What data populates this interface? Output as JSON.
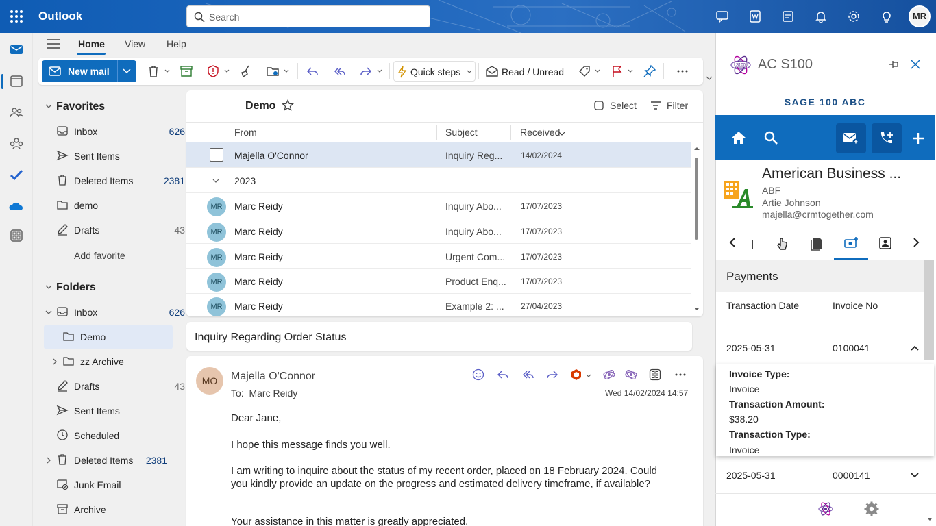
{
  "app": {
    "brand": "Outlook",
    "search_placeholder": "Search",
    "avatar_initials": "MR"
  },
  "tabs": [
    "Home",
    "View",
    "Help"
  ],
  "ribbon": {
    "new_mail": "New mail",
    "quick_steps": "Quick steps",
    "read_unread": "Read / Unread"
  },
  "favorites": {
    "title": "Favorites",
    "items": [
      {
        "label": "Inbox",
        "count": "626"
      },
      {
        "label": "Sent Items",
        "count": ""
      },
      {
        "label": "Deleted Items",
        "count": "2381"
      },
      {
        "label": "demo",
        "count": ""
      },
      {
        "label": "Drafts",
        "count": "43"
      }
    ],
    "add": "Add favorite"
  },
  "folders": {
    "title": "Folders",
    "items": [
      {
        "label": "Inbox",
        "count": "626"
      },
      {
        "label": "Demo",
        "count": ""
      },
      {
        "label": "zz Archive",
        "count": ""
      },
      {
        "label": "Drafts",
        "count": "43"
      },
      {
        "label": "Sent Items",
        "count": ""
      },
      {
        "label": "Scheduled",
        "count": ""
      },
      {
        "label": "Deleted Items",
        "count": "2381"
      },
      {
        "label": "Junk Email",
        "count": ""
      },
      {
        "label": "Archive",
        "count": ""
      }
    ]
  },
  "list": {
    "title": "Demo",
    "select": "Select",
    "filter": "Filter",
    "columns": {
      "from": "From",
      "subject": "Subject",
      "received": "Received"
    },
    "pinned": {
      "from": "Majella O'Connor",
      "subject": "Inquiry Reg...",
      "date": "14/02/2024"
    },
    "group": "2023",
    "rows": [
      {
        "initials": "MR",
        "from": "Marc Reidy",
        "subject": "Inquiry Abo...",
        "date": "17/07/2023"
      },
      {
        "initials": "MR",
        "from": "Marc Reidy",
        "subject": "Inquiry Abo...",
        "date": "17/07/2023"
      },
      {
        "initials": "MR",
        "from": "Marc Reidy",
        "subject": "Urgent Com...",
        "date": "17/07/2023"
      },
      {
        "initials": "MR",
        "from": "Marc Reidy",
        "subject": "Product Enq...",
        "date": "17/07/2023"
      },
      {
        "initials": "MR",
        "from": "Marc Reidy",
        "subject": "Example 2: ...",
        "date": "27/04/2023"
      }
    ]
  },
  "message": {
    "subject": "Inquiry Regarding Order Status",
    "sender_initials": "MO",
    "sender": "Majella O'Connor",
    "to_label": "To:",
    "to": "Marc Reidy",
    "date": "Wed 14/02/2024 14:57",
    "body": [
      "Dear Jane,",
      "I hope this message finds you well.",
      "I am writing to inquire about the status of my recent order, placed on 18 February 2024. Could you kindly provide an update on the progress and estimated delivery timeframe, if available?",
      "Your assistance in this matter is greatly appreciated."
    ]
  },
  "addin": {
    "title": "AC S100",
    "subtitle": "SAGE 100 ABC",
    "company": {
      "name": "American Business ...",
      "code": "ABF",
      "contact": "Artie Johnson",
      "email": "majella@crmtogether.com"
    },
    "section": "Payments",
    "columns": [
      "Transaction Date",
      "Invoice No"
    ],
    "records": [
      {
        "date": "2025-05-31",
        "invoice": "0100041"
      },
      {
        "date": "2025-05-31",
        "invoice": "0000141"
      }
    ],
    "details": [
      {
        "label": "Invoice Type:",
        "value": "Invoice"
      },
      {
        "label": "Transaction Amount:",
        "value": "$38.20"
      },
      {
        "label": "Transaction Type:",
        "value": "Invoice"
      }
    ]
  }
}
